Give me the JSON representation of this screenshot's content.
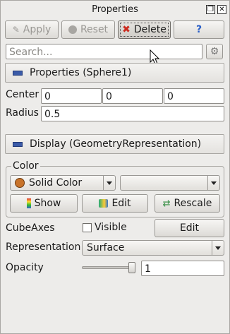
{
  "panel": {
    "title": "Properties"
  },
  "toolbar": {
    "apply": "Apply",
    "reset": "Reset",
    "delete": "Delete",
    "help": "?"
  },
  "search": {
    "placeholder": "Search..."
  },
  "properties_section": {
    "label": "Properties (Sphere1)"
  },
  "center": {
    "label": "Center",
    "x": "0",
    "y": "0",
    "z": "0"
  },
  "radius": {
    "label": "Radius",
    "value": "0.5"
  },
  "display_section": {
    "label": "Display (GeometryRepresentation)"
  },
  "color_group": {
    "title": "Color",
    "mode": "Solid Color",
    "component": "",
    "show_label": "Show",
    "edit_label": "Edit",
    "rescale_label": "Rescale",
    "swatch_color": "#c8732a"
  },
  "cube_axes": {
    "label": "CubeAxes",
    "visible_label": "Visible",
    "edit_label": "Edit",
    "checked": false
  },
  "representation": {
    "label": "Representation",
    "value": "Surface"
  },
  "opacity": {
    "label": "Opacity",
    "value": "1",
    "fraction": 1.0
  },
  "icons": [
    "float-window-icon",
    "close-icon",
    "apply-icon",
    "reset-icon",
    "delete-icon",
    "help-icon",
    "settings-gear-icon",
    "collapse-icon",
    "color-swatch-icon",
    "colorbar-icon",
    "edit-colormap-icon",
    "rescale-icon"
  ]
}
